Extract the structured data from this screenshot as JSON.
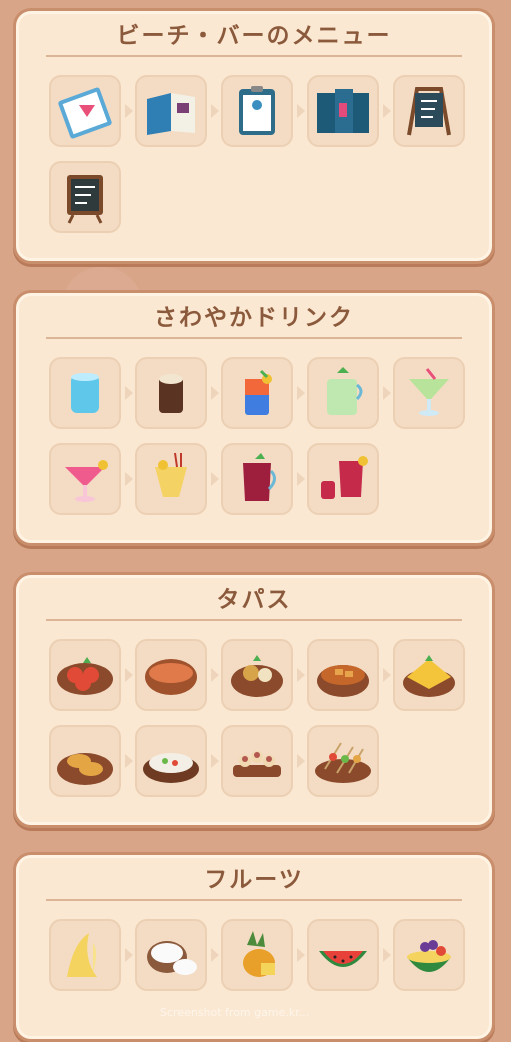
{
  "sections": [
    {
      "title": "ビーチ・バーのメニュー",
      "items": [
        {
          "icon": "cocktail-menu-card-icon"
        },
        {
          "icon": "folded-menu-icon"
        },
        {
          "icon": "clipboard-menu-icon"
        },
        {
          "icon": "tri-fold-menu-icon"
        },
        {
          "icon": "a-frame-menu-board-icon"
        },
        {
          "icon": "chalkboard-sign-icon"
        }
      ]
    },
    {
      "title": "さわやかドリンク",
      "items": [
        {
          "icon": "water-glass-icon"
        },
        {
          "icon": "iced-coffee-icon"
        },
        {
          "icon": "layered-cocktail-icon"
        },
        {
          "icon": "mojito-jug-icon"
        },
        {
          "icon": "margarita-glass-icon"
        },
        {
          "icon": "pink-cocktail-icon"
        },
        {
          "icon": "tropical-smoothie-icon"
        },
        {
          "icon": "sangria-pitcher-icon"
        },
        {
          "icon": "sangria-set-icon"
        }
      ]
    },
    {
      "title": "タパス",
      "items": [
        {
          "icon": "tomato-plate-icon"
        },
        {
          "icon": "soup-bowl-icon"
        },
        {
          "icon": "potato-bowl-icon"
        },
        {
          "icon": "stew-bowl-icon"
        },
        {
          "icon": "tortilla-icon"
        },
        {
          "icon": "croquettes-icon"
        },
        {
          "icon": "salad-icon"
        },
        {
          "icon": "octopus-pintxos-icon"
        },
        {
          "icon": "skewers-icon"
        }
      ]
    },
    {
      "title": "フルーツ",
      "items": [
        {
          "icon": "banana-icon"
        },
        {
          "icon": "coconut-icon"
        },
        {
          "icon": "pineapple-icon"
        },
        {
          "icon": "watermelon-slice-icon"
        },
        {
          "icon": "fruit-basket-icon"
        }
      ]
    }
  ],
  "watermark": "Screenshot from game.kr...",
  "colors": {
    "background": "#d9a589",
    "panel": "#fbe8d2",
    "title": "#8b5a3c"
  }
}
